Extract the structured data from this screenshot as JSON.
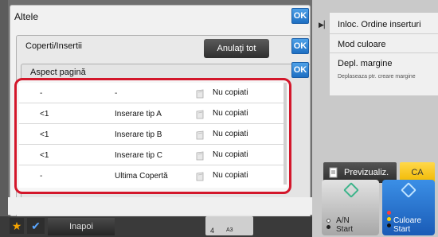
{
  "dialogs": {
    "altele_title": "Altele",
    "coperti_title": "Coperti/Insertii",
    "anulati_label": "Anulaţi tot",
    "aspect_title": "Aspect pagină",
    "ok_label": "OK"
  },
  "table": {
    "rows": [
      {
        "col1": "-",
        "col2": "-",
        "col3": "Nu copiati"
      },
      {
        "col1": "<1",
        "col2": "Inserare tip A",
        "col3": "Nu copiati"
      },
      {
        "col1": "<1",
        "col2": "Inserare tip B",
        "col3": "Nu copiati"
      },
      {
        "col1": "<1",
        "col2": "Inserare tip C",
        "col3": "Nu copiati"
      },
      {
        "col1": "-",
        "col2": "Ultima Copertă",
        "col3": "Nu copiati"
      }
    ],
    "row_icon": "copy-sheet-icon"
  },
  "footer": {
    "back_label": "Inapoi",
    "paper_count": "4",
    "paper_size": "A3"
  },
  "right_panel": {
    "menu": [
      {
        "label": "Inloc. Ordine inserturi"
      },
      {
        "label": "Mod culoare"
      },
      {
        "label": "Depl. margine",
        "sub": "Deplaseaza ptr. creare margine"
      }
    ],
    "preview_label": "Previzualiz.",
    "ca_label": "CA",
    "start_bw_line1": "A/N",
    "start_bw_line2": "Start",
    "start_color_line1": "Culoare",
    "start_color_line2": "Start"
  },
  "colors": {
    "highlight": "#d3172b",
    "ok_blue": "#1e6fc2",
    "start_color": "#1a5bb6",
    "ca_yellow": "#f0b800"
  }
}
